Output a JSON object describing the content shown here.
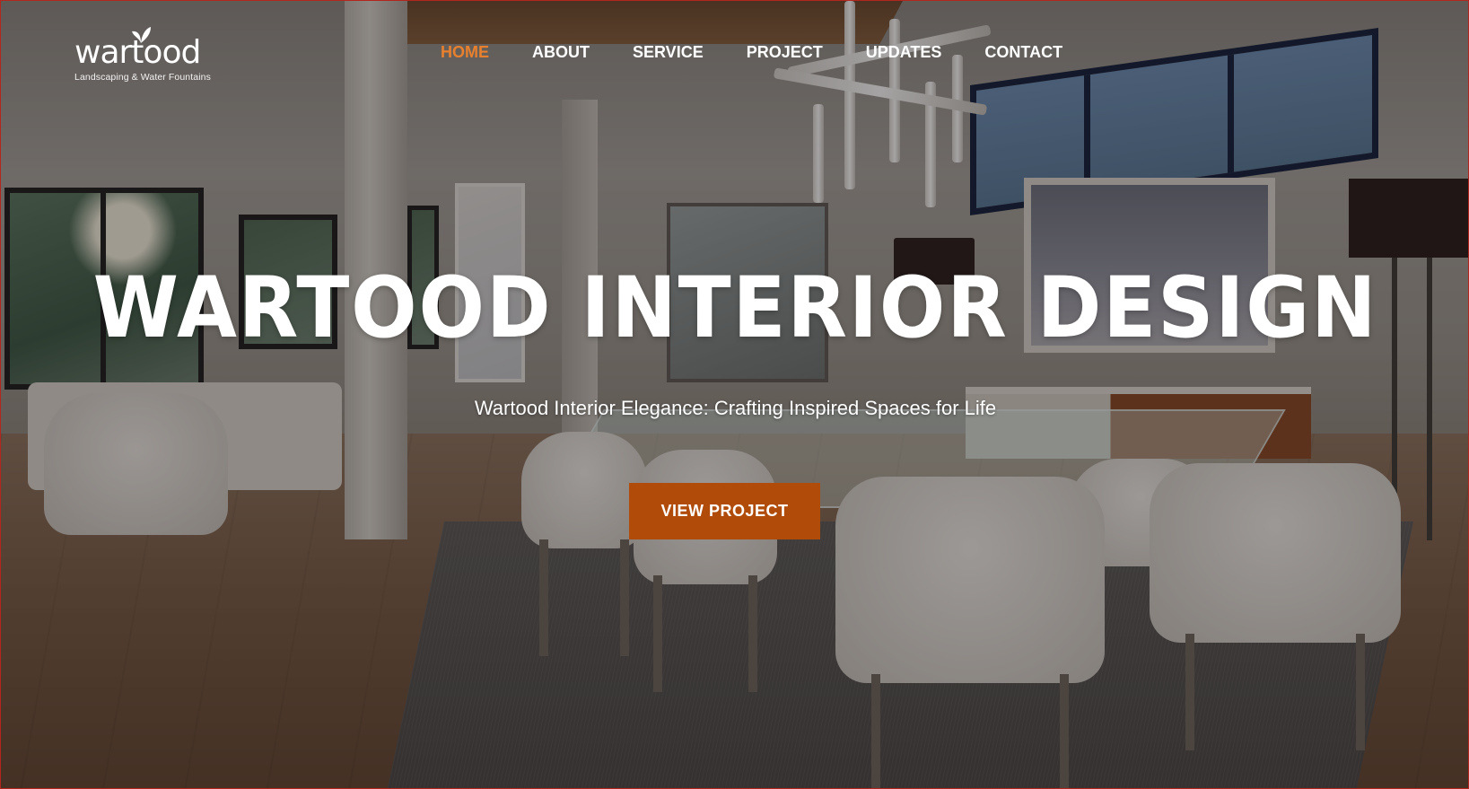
{
  "brand": {
    "logo_text": "wartood",
    "tagline": "Landscaping & Water Fountains"
  },
  "nav": {
    "items": [
      {
        "label": "HOME",
        "active": true
      },
      {
        "label": "ABOUT",
        "active": false
      },
      {
        "label": "SERVICE",
        "active": false
      },
      {
        "label": "PROJECT",
        "active": false
      },
      {
        "label": "UPDATES",
        "active": false
      },
      {
        "label": "CONTACT",
        "active": false
      }
    ]
  },
  "hero": {
    "title": "WARTOOD INTERIOR DESIGN",
    "subtitle": "Wartood Interior Elegance: Crafting Inspired Spaces for Life",
    "cta_label": "VIEW PROJECT",
    "background_image": "dining-room-interior-photo"
  },
  "colors": {
    "accent": "#e8802e",
    "button": "#b14b0a",
    "text": "#ffffff"
  },
  "icons": [
    "leaf-icon"
  ]
}
